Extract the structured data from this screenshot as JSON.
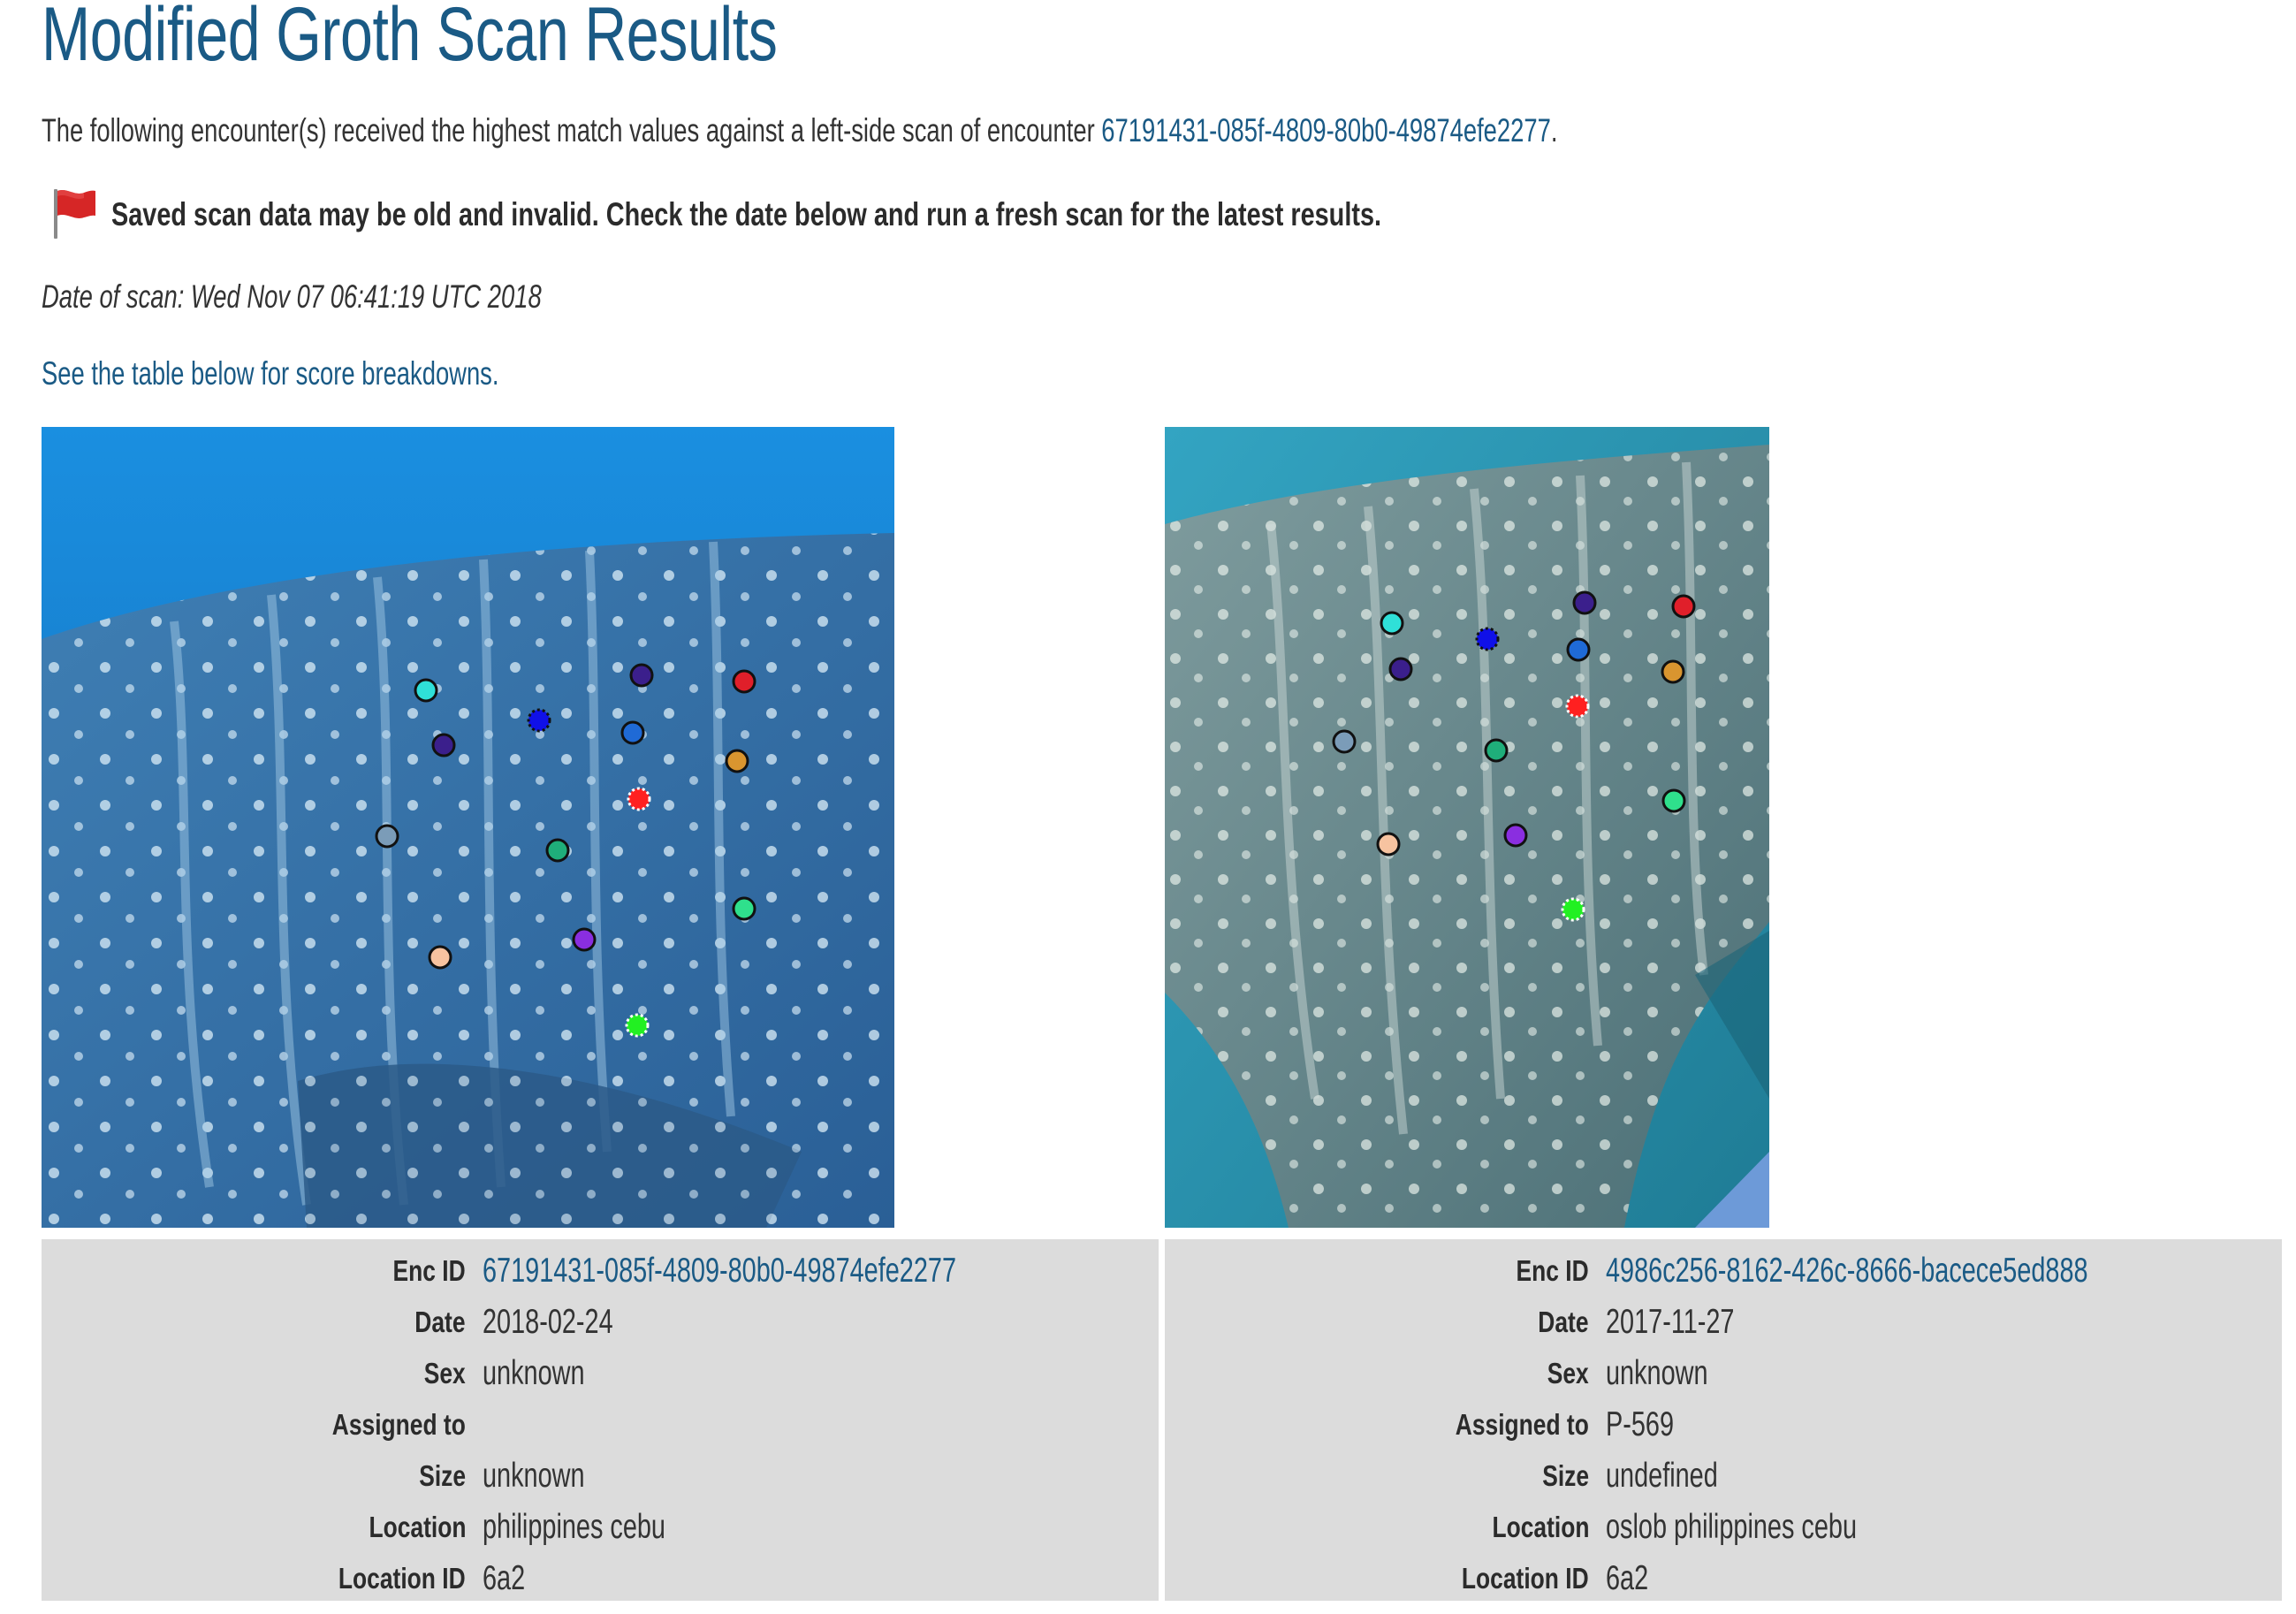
{
  "page": {
    "title": "Modified Groth Scan Results",
    "intro_prefix": "The following encounter(s) received the highest match values against a left-side scan of encounter ",
    "intro_encounter": "67191431-085f-4809-80b0-49874efe2277",
    "intro_suffix": ".",
    "warning": "Saved scan data may be old and invalid. Check the date below and run a fresh scan for the latest results.",
    "scan_date": "Date of scan: Wed Nov 07 06:41:19 UTC 2018",
    "table_link": "See the table below for score breakdowns."
  },
  "labels": {
    "enc_id": "Enc ID",
    "date": "Date",
    "sex": "Sex",
    "assigned_to": "Assigned to",
    "size": "Size",
    "location": "Location",
    "location_id": "Location ID"
  },
  "left_encounter": {
    "enc_id": "67191431-085f-4809-80b0-49874efe2277",
    "date": "2018-02-24",
    "sex": "unknown",
    "assigned_to": "",
    "size": "unknown",
    "location": "philippines cebu",
    "location_id": "6a2"
  },
  "right_encounter": {
    "enc_id": "4986c256-8162-426c-8666-bacece5ed888",
    "date": "2017-11-27",
    "sex": "unknown",
    "assigned_to": "P-569",
    "size": "undefined",
    "location": "oslob philippines cebu",
    "location_id": "6a2"
  },
  "colors": {
    "link": "#1a5a85",
    "panel": "#dcdcdc",
    "flag": "#d62626",
    "water_left": "#1f74c0",
    "water_right": "#2a8fa8"
  },
  "icons": {
    "warning": "red-flag-icon"
  }
}
